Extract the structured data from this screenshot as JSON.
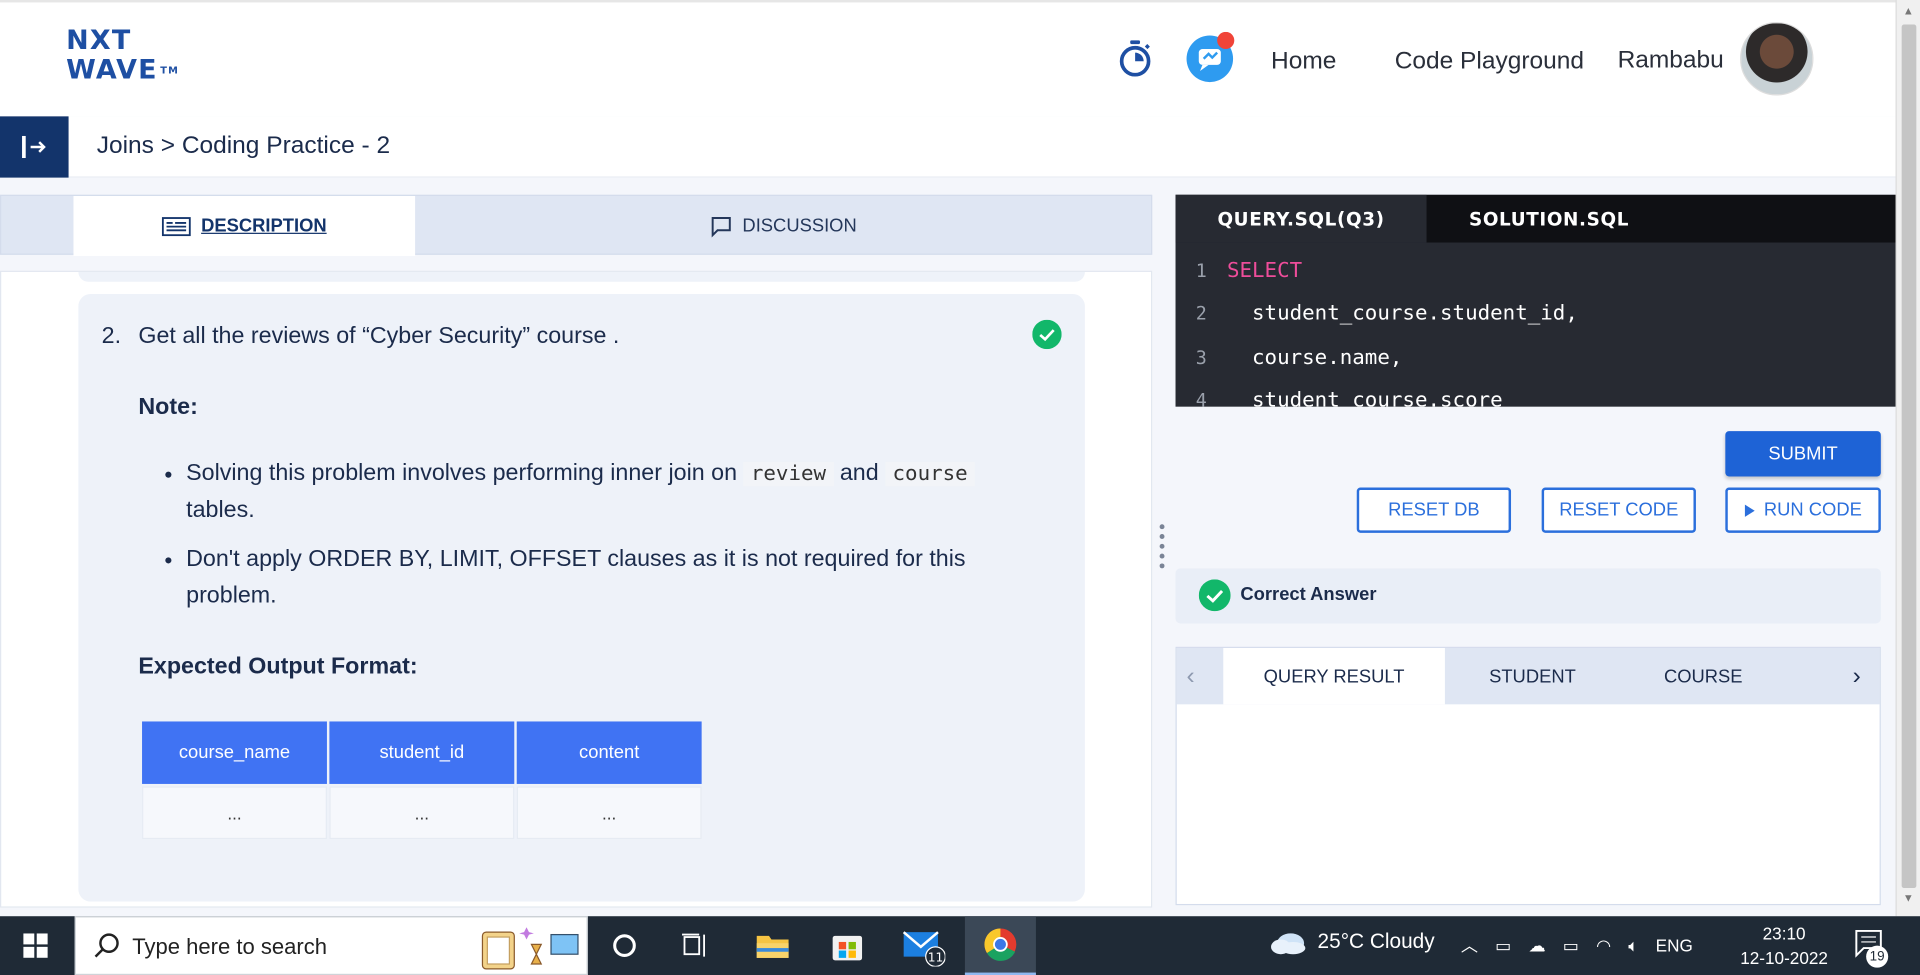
{
  "header": {
    "logo_line1": "NXT",
    "logo_line2": "WAVE",
    "logo_tm": "TM",
    "nav_home": "Home",
    "nav_playground": "Code Playground",
    "user_name": "Rambabu"
  },
  "breadcrumb": "Joins > Coding Practice - 2",
  "left_tabs": {
    "description": "DESCRIPTION",
    "discussion": "DISCUSSION"
  },
  "question": {
    "number": "2.",
    "text": "Get all the reviews of “Cyber Security” course .",
    "note_heading": "Note:",
    "bullet1_pre": "Solving this problem involves performing inner join on",
    "bullet1_code1": "review",
    "bullet1_mid": "and",
    "bullet1_code2": "course",
    "bullet1_post": "tables.",
    "bullet2": "Don't apply ORDER BY, LIMIT, OFFSET clauses as it is not required for this problem.",
    "expected_heading": "Expected Output Format:",
    "table_headers": [
      "course_name",
      "student_id",
      "content"
    ],
    "table_row": [
      "...",
      "...",
      "..."
    ]
  },
  "editor": {
    "tab_active": "QUERY.SQL(Q3)",
    "tab_other": "SOLUTION.SQL",
    "lines": [
      {
        "n": "1",
        "text": "SELECT"
      },
      {
        "n": "2",
        "text": "  student_course.student_id,"
      },
      {
        "n": "3",
        "text": "  course.name,"
      },
      {
        "n": "4",
        "text": "  student_course.score"
      }
    ]
  },
  "buttons": {
    "submit": "SUBMIT",
    "reset_db": "RESET DB",
    "reset_code": "RESET CODE",
    "run_code": "RUN CODE"
  },
  "result_status": "Correct Answer",
  "result_tabs": [
    "QUERY RESULT",
    "STUDENT",
    "COURSE"
  ],
  "taskbar": {
    "search_placeholder": "Type here to search",
    "mail_badge": "11",
    "weather": "25°C  Cloudy",
    "lang": "ENG",
    "time": "23:10",
    "date": "12-10-2022",
    "notification_count": "19"
  },
  "colors": {
    "brand_navy": "#13346b",
    "accent_blue": "#2b6fdc",
    "table_header_blue": "#4073f3",
    "success_green": "#12b76a",
    "sql_keyword_pink": "#ee4d9a"
  }
}
